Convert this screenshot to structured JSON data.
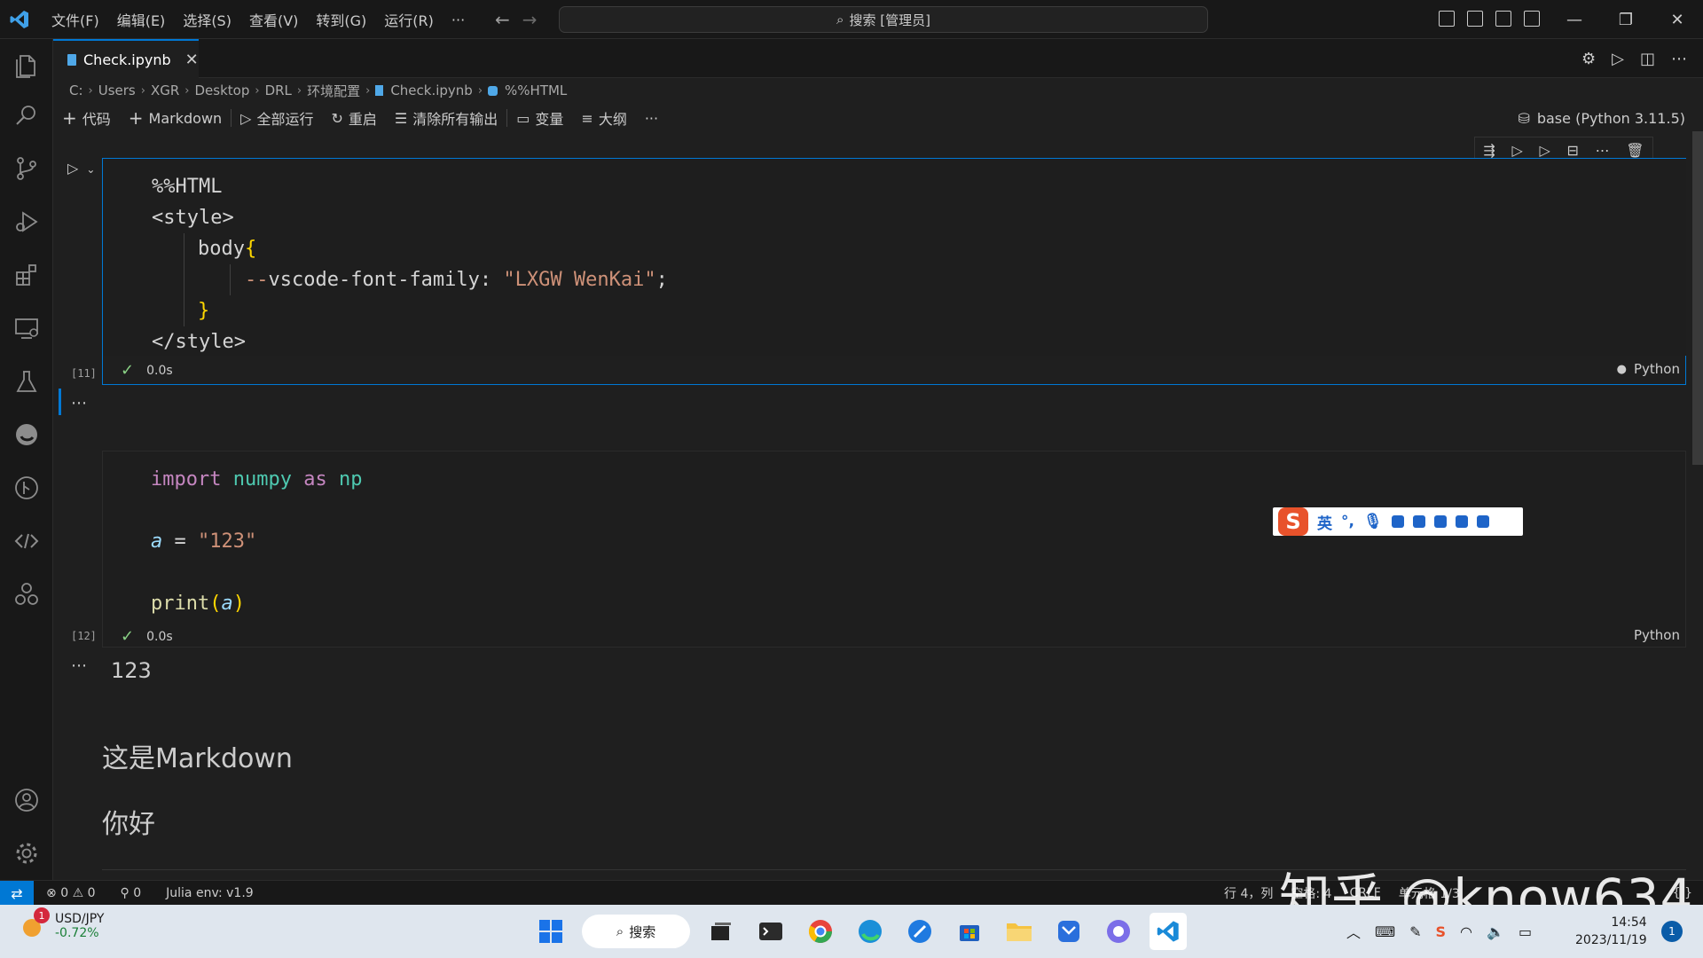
{
  "titlebar": {
    "menu": [
      "文件(F)",
      "编辑(E)",
      "选择(S)",
      "查看(V)",
      "转到(G)",
      "运行(R)",
      "···"
    ],
    "search_label": "搜索 [管理员]"
  },
  "tab": {
    "label": "Check.ipynb",
    "close": "✕"
  },
  "breadcrumb": [
    "C:",
    "Users",
    "XGR",
    "Desktop",
    "DRL",
    "环境配置",
    "Check.ipynb",
    "%%HTML"
  ],
  "toolbar": {
    "code": "代码",
    "markdown": "Markdown",
    "run_all": "全部运行",
    "restart": "重启",
    "clear_outputs": "清除所有输出",
    "variables": "变量",
    "outline": "大纲",
    "more": "···",
    "kernel": "base (Python 3.11.5)"
  },
  "cell1": {
    "lines": {
      "l1": "%%HTML",
      "l2": "<style>",
      "l3": "body",
      "l3b": "{",
      "l4a": "--",
      "l4b": "vscode-font-family",
      "l4c": ": ",
      "l4d": "\"LXGW WenKai\"",
      "l4e": ";",
      "l5": "}",
      "l6": "</style>"
    },
    "exec_count": "[11]",
    "duration": "0.0s",
    "language": "Python"
  },
  "cell2": {
    "line1_kw": "import",
    "line1_mod": "numpy",
    "line1_as": "as",
    "line1_alias": "np",
    "line2_var": "a",
    "line2_eq": " = ",
    "line2_str": "\"123\"",
    "line3_fn": "print",
    "line3_open": "(",
    "line3_arg": "a",
    "line3_close": ")",
    "exec_count": "[12]",
    "duration": "0.0s",
    "language": "Python",
    "output": "123"
  },
  "markdown": {
    "line1": "这是Markdown",
    "line2": "你好"
  },
  "ime": {
    "mode": "英",
    "punct": "°,"
  },
  "statusbar": {
    "problems_errors": "0",
    "problems_warnings": "0",
    "ports": "0",
    "julia": "Julia env: v1.9",
    "position": "行 4，列",
    "spaces": "空格: 4",
    "eol": "CRLF",
    "cell_info": "单元格 1/3",
    "misc": "{ }"
  },
  "watermark": "知乎 @know634",
  "taskbar": {
    "ticker": "USD/JPY",
    "change": "-0.72%",
    "badge": "1",
    "search": "搜索",
    "time": "14:54",
    "date": "2023/11/19",
    "notifications": "1"
  }
}
